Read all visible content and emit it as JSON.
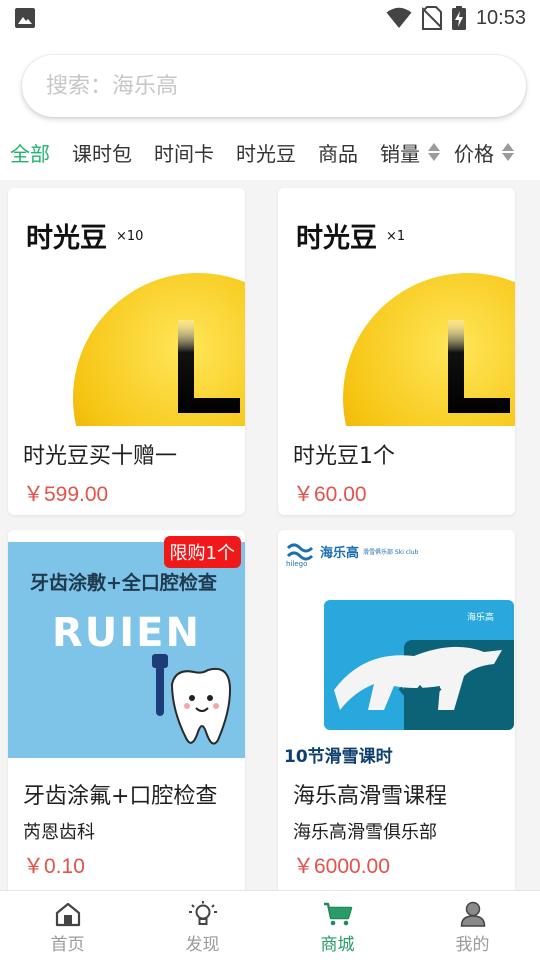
{
  "status_bar": {
    "time": "10:53"
  },
  "search": {
    "placeholder": "搜索：海乐高"
  },
  "filters": {
    "tabs": [
      "全部",
      "课时包",
      "时间卡",
      "时光豆",
      "商品"
    ],
    "active_tab": "全部",
    "sort_sales": "销量",
    "sort_price": "价格"
  },
  "products": [
    {
      "image_title": "时光豆",
      "image_multiplier": "×10",
      "image_letter": "L",
      "name": "时光豆买十赠一",
      "price": "￥599.00"
    },
    {
      "image_title": "时光豆",
      "image_multiplier": "×1",
      "image_letter": "L",
      "name": "时光豆1个",
      "price": "￥60.00"
    },
    {
      "image_banner": "牙齿涂敷+全口腔检查",
      "image_brand": "RUIEN",
      "badge": "限购1个",
      "name": "牙齿涂氟+口腔检查",
      "shop": "芮恩齿科",
      "price": "￥0.10"
    },
    {
      "image_logo": "海乐高",
      "image_logo_en": "hilego",
      "image_logo_sub": "滑雪俱乐部 Ski club",
      "image_card_brand": "海乐高",
      "image_caption": "10节滑雪课时",
      "name": "海乐高滑雪课程",
      "shop": "海乐高滑雪俱乐部",
      "price": "￥6000.00"
    }
  ],
  "bottom_nav": [
    {
      "label": "首页",
      "icon": "home-icon"
    },
    {
      "label": "发现",
      "icon": "lightbulb-icon"
    },
    {
      "label": "商城",
      "icon": "cart-icon",
      "active": true
    },
    {
      "label": "我的",
      "icon": "user-icon"
    }
  ],
  "colors": {
    "accent": "#24b36b",
    "price": "#e2534a",
    "badge": "#f01818"
  }
}
